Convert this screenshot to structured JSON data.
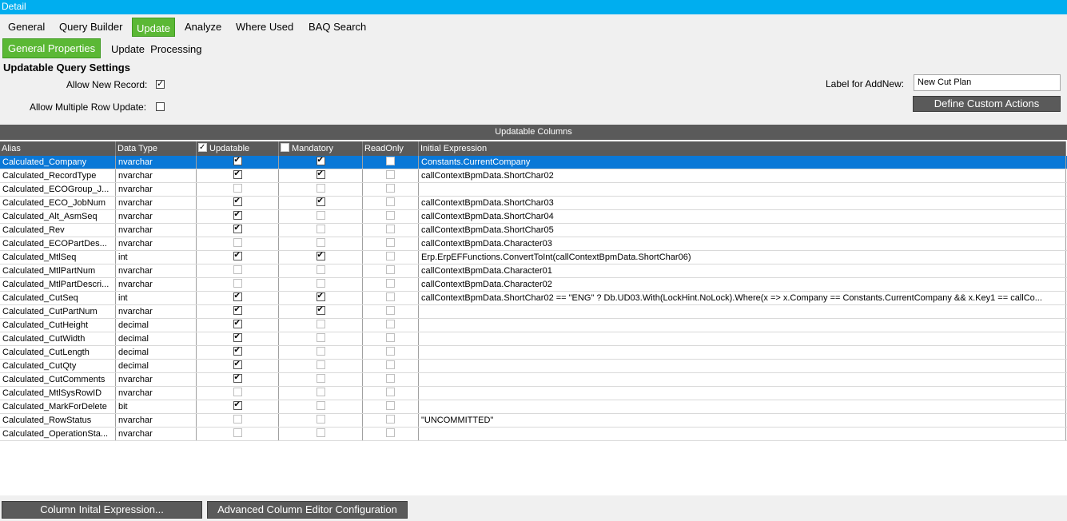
{
  "window_title": "Detail",
  "main_tabs": [
    {
      "label": "General"
    },
    {
      "label": "Query Builder"
    },
    {
      "label": "Update"
    },
    {
      "label": "Analyze"
    },
    {
      "label": "Where Used"
    },
    {
      "label": "BAQ Search"
    }
  ],
  "sub_tabs": [
    {
      "label": "General Properties"
    },
    {
      "label": "Update  Processing"
    }
  ],
  "settings": {
    "title": "Updatable Query Settings",
    "allow_new_record_label": "Allow New Record:",
    "allow_new_record": true,
    "allow_multiple_row_update_label": "Allow Multiple Row Update:",
    "allow_multiple_row_update": false,
    "label_for_addnew_label": "Label for AddNew:",
    "label_for_addnew_value": "New Cut Plan",
    "define_custom_actions_label": "Define Custom Actions"
  },
  "grid": {
    "title": "Updatable Columns",
    "headers": {
      "alias": "Alias",
      "data_type": "Data Type",
      "updatable": "Updatable",
      "mandatory": "Mandatory",
      "readonly": "ReadOnly",
      "initial_expression": "Initial Expression"
    },
    "header_updatable_checked": true,
    "header_mandatory_checked": false,
    "rows": [
      {
        "alias": "Calculated_Company",
        "type": "nvarchar",
        "upd": true,
        "man": true,
        "ro": false,
        "expr": "Constants.CurrentCompany",
        "selected": true
      },
      {
        "alias": "Calculated_RecordType",
        "type": "nvarchar",
        "upd": true,
        "man": true,
        "ro": false,
        "expr": "callContextBpmData.ShortChar02"
      },
      {
        "alias": "Calculated_ECOGroup_J...",
        "type": "nvarchar",
        "upd": false,
        "man": false,
        "ro": false,
        "expr": ""
      },
      {
        "alias": "Calculated_ECO_JobNum",
        "type": "nvarchar",
        "upd": true,
        "man": true,
        "ro": false,
        "expr": "callContextBpmData.ShortChar03"
      },
      {
        "alias": "Calculated_Alt_AsmSeq",
        "type": "nvarchar",
        "upd": true,
        "man": false,
        "ro": false,
        "expr": "callContextBpmData.ShortChar04"
      },
      {
        "alias": "Calculated_Rev",
        "type": "nvarchar",
        "upd": true,
        "man": false,
        "ro": false,
        "expr": "callContextBpmData.ShortChar05"
      },
      {
        "alias": "Calculated_ECOPartDes...",
        "type": "nvarchar",
        "upd": false,
        "man": false,
        "ro": false,
        "expr": "callContextBpmData.Character03"
      },
      {
        "alias": "Calculated_MtlSeq",
        "type": "int",
        "upd": true,
        "man": true,
        "ro": false,
        "expr": "Erp.ErpEFFunctions.ConvertToInt(callContextBpmData.ShortChar06)"
      },
      {
        "alias": "Calculated_MtlPartNum",
        "type": "nvarchar",
        "upd": false,
        "man": false,
        "ro": false,
        "expr": "callContextBpmData.Character01"
      },
      {
        "alias": "Calculated_MtlPartDescri...",
        "type": "nvarchar",
        "upd": false,
        "man": false,
        "ro": false,
        "expr": "callContextBpmData.Character02"
      },
      {
        "alias": "Calculated_CutSeq",
        "type": "int",
        "upd": true,
        "man": true,
        "ro": false,
        "expr": "callContextBpmData.ShortChar02 == \"ENG\" ? Db.UD03.With(LockHint.NoLock).Where(x => x.Company == Constants.CurrentCompany && x.Key1 == callCo..."
      },
      {
        "alias": "Calculated_CutPartNum",
        "type": "nvarchar",
        "upd": true,
        "man": true,
        "ro": false,
        "expr": ""
      },
      {
        "alias": "Calculated_CutHeight",
        "type": "decimal",
        "upd": true,
        "man": false,
        "ro": false,
        "expr": ""
      },
      {
        "alias": "Calculated_CutWidth",
        "type": "decimal",
        "upd": true,
        "man": false,
        "ro": false,
        "expr": ""
      },
      {
        "alias": "Calculated_CutLength",
        "type": "decimal",
        "upd": true,
        "man": false,
        "ro": false,
        "expr": ""
      },
      {
        "alias": "Calculated_CutQty",
        "type": "decimal",
        "upd": true,
        "man": false,
        "ro": false,
        "expr": ""
      },
      {
        "alias": "Calculated_CutComments",
        "type": "nvarchar",
        "upd": true,
        "man": false,
        "ro": false,
        "expr": ""
      },
      {
        "alias": "Calculated_MtlSysRowID",
        "type": "nvarchar",
        "upd": false,
        "man": false,
        "ro": false,
        "expr": ""
      },
      {
        "alias": "Calculated_MarkForDelete",
        "type": "bit",
        "upd": true,
        "man": false,
        "ro": false,
        "expr": ""
      },
      {
        "alias": "Calculated_RowStatus",
        "type": "nvarchar",
        "upd": false,
        "man": false,
        "ro": false,
        "expr": "\"UNCOMMITTED\""
      },
      {
        "alias": "Calculated_OperationSta...",
        "type": "nvarchar",
        "upd": false,
        "man": false,
        "ro": false,
        "expr": ""
      }
    ]
  },
  "bottom_buttons": {
    "column_initial_expression": "Column Inital Expression...",
    "advanced_column_editor": "Advanced Column Editor Configuration"
  },
  "colors": {
    "title_bar": "#00aeef",
    "active_tab": "#5bb835",
    "selected_row": "#0a78d7",
    "dark_header": "#5a5a5a"
  }
}
